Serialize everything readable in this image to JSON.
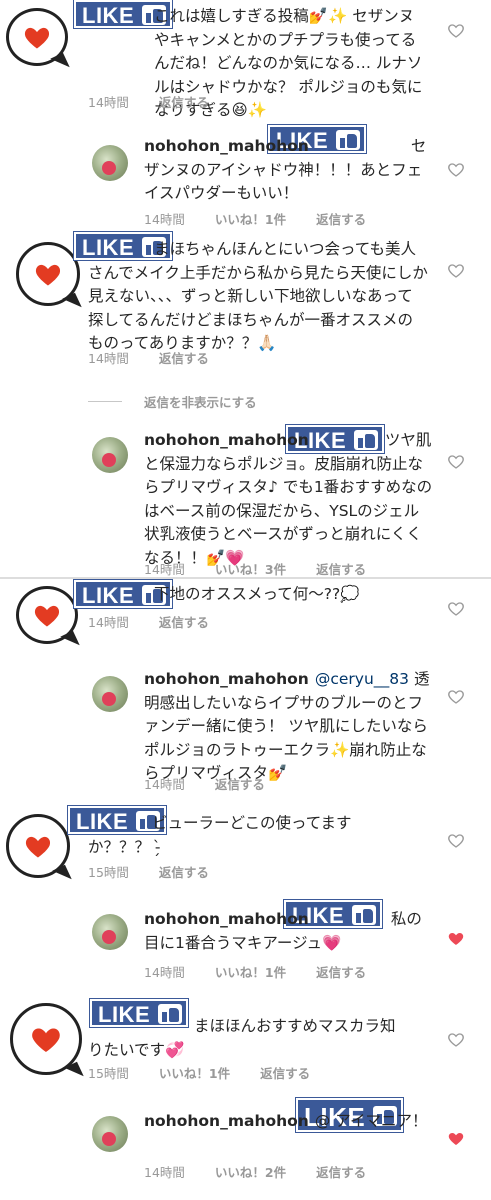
{
  "colors": {
    "like_blue": "#3b5998",
    "liked_heart": "#ed4956",
    "meta_gray": "#999999"
  },
  "comments": [
    {
      "id": "c1",
      "text": "これは嬉しすぎる投稿💅✨ セザンヌやキャンメとかのプチプラも使ってるんだね！どんなのか気になる… ルナソルはシャドウかな？ ポルジョのも気になりすぎる😆✨",
      "time": "14時間",
      "reply": "返信する"
    },
    {
      "id": "r1",
      "user": "nohohon_mahohon",
      "text": "セザンヌのアイシャドウ神！！！あとフェイスパウダーもいい！",
      "time": "14時間",
      "likes": "いいね！1件",
      "reply": "返信する"
    },
    {
      "id": "c2",
      "text": "まほちゃんほんとにいつ会っても美人さんでメイク上手だから私から見たら天使にしか見えない、、、ずっと新しい下地欲しいなあって探してるんだけどまほちゃんが一番オススメのものってありますか？？🙏🏻",
      "time": "14時間",
      "reply": "返信する"
    },
    {
      "id": "r2",
      "user": "nohohon_mahohon",
      "text": "ツヤ肌と保湿力ならポルジョ。皮脂崩れ防止ならプリマヴィスタ♪ でも1番おすすめなのはベース前の保湿だから、YSLのジェル状乳液使うとベースがずっと崩れにくくなる！！💅💗",
      "time": "14時間",
      "likes": "いいね！3件",
      "reply": "返信する"
    },
    {
      "id": "c3",
      "text": "下地のオススメって何〜??💭",
      "time": "14時間",
      "reply": "返信する"
    },
    {
      "id": "r3",
      "user": "nohohon_mahohon",
      "mention": "@ceryu__83",
      "text": "透明感出したいならイプサのブルーのとファンデー緒に使う！ ツヤ肌にしたいならポルジョのラトゥーエクラ✨崩れ防止ならプリマヴィスタ💅",
      "time": "14時間",
      "reply": "返信する"
    },
    {
      "id": "c4",
      "text": "ビューラーどこの使ってますか？？？ -̗̀",
      "time": "15時間",
      "reply": "返信する"
    },
    {
      "id": "r4",
      "user": "nohohon_mahohon",
      "text": "私の目に1番合うマキアージュ💗",
      "time": "14時間",
      "likes": "いいね！1件",
      "reply": "返信する"
    },
    {
      "id": "c5",
      "text": "まほほんおすすめマスカラ知りたいです💞",
      "time": "15時間",
      "likes": "いいね！1件",
      "reply": "返信する"
    },
    {
      "id": "r5",
      "user": "nohohon_mahohon",
      "text": "@ アイマニア！",
      "time": "14時間",
      "likes": "いいね！2件",
      "reply": "返信する"
    }
  ],
  "hide_replies_label": "返信を非表示にする",
  "like_sticker_label": "LIKE"
}
